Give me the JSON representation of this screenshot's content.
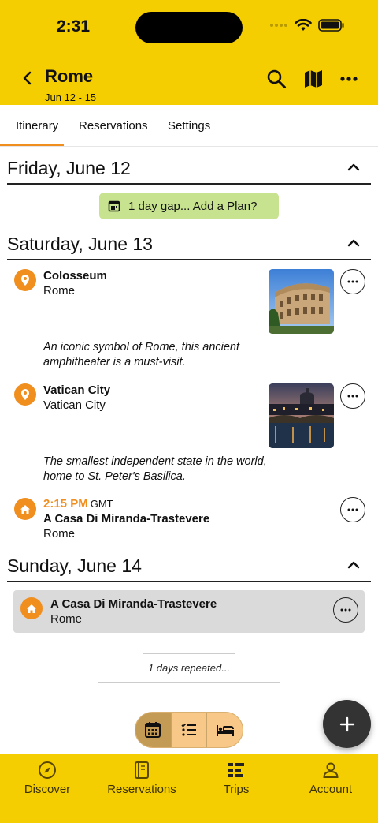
{
  "status_bar": {
    "time": "2:31"
  },
  "header": {
    "title": "Rome",
    "dates": "Jun 12 - 15"
  },
  "tabs": [
    {
      "label": "Itinerary"
    },
    {
      "label": "Reservations"
    },
    {
      "label": "Settings"
    }
  ],
  "days": [
    {
      "title": "Friday, June 12",
      "gap_label": "1 day gap... Add a Plan?"
    },
    {
      "title": "Saturday, June 13",
      "items": [
        {
          "name": "Colosseum",
          "location": "Rome",
          "description": "An iconic symbol of Rome, this ancient amphitheater is a must-visit."
        },
        {
          "name": "Vatican City",
          "location": "Vatican City",
          "description": "The smallest independent state in the world, home to St. Peter's Basilica."
        },
        {
          "time": "2:15 PM",
          "timezone": "GMT",
          "name": "A Casa Di Miranda-Trastevere",
          "location": "Rome"
        }
      ]
    },
    {
      "title": "Sunday, June 14",
      "items": [
        {
          "name": "A Casa Di Miranda-Trastevere",
          "location": "Rome"
        }
      ],
      "repeated_label": "1 days repeated..."
    }
  ],
  "bottom_nav": [
    {
      "label": "Discover",
      "icon": "compass-icon"
    },
    {
      "label": "Reservations",
      "icon": "notebook-icon"
    },
    {
      "label": "Trips",
      "icon": "list-icon"
    },
    {
      "label": "Account",
      "icon": "person-icon"
    }
  ],
  "colors": {
    "header": "#F5CE02",
    "accent": "#F08E1E",
    "gap_chip": "#C7E38F",
    "fab": "#333333"
  }
}
